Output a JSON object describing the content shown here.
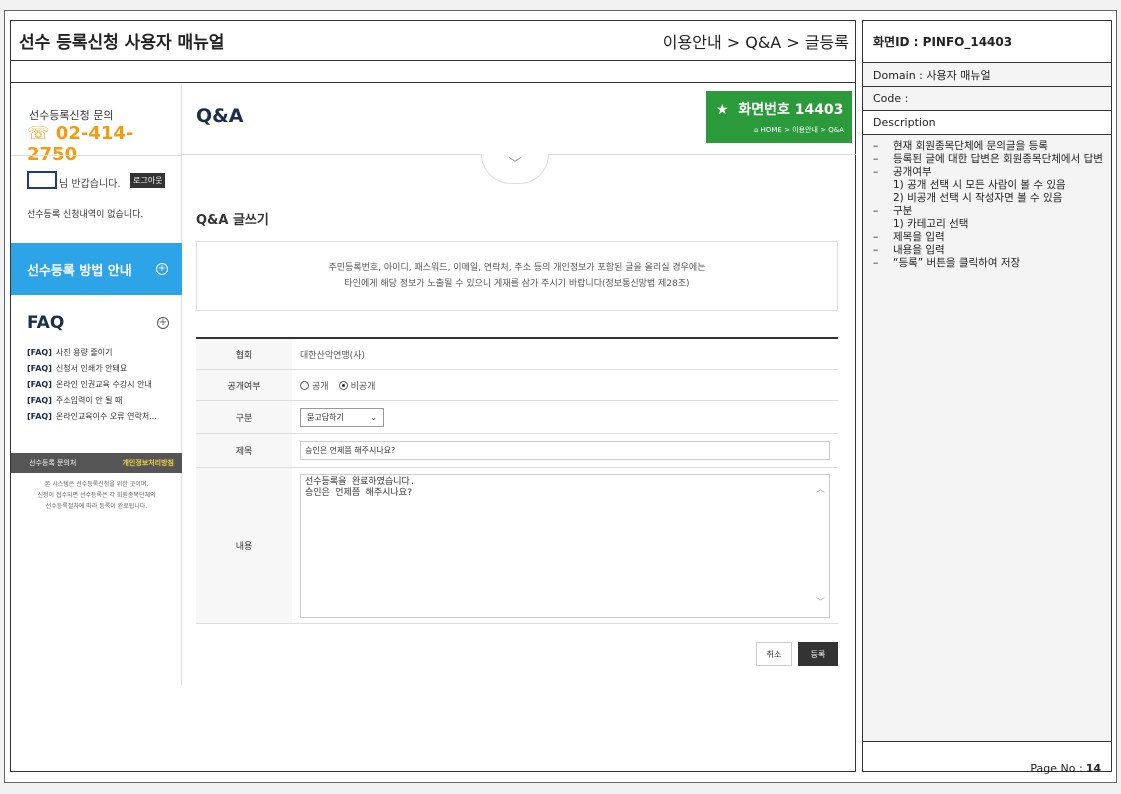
{
  "manual": {
    "title": "선수 등록신청 사용자 매뉴얼",
    "breadcrumb": "이용안내 > Q&A > 글등록"
  },
  "sidebar": {
    "inquiry_title": "선수등록신청 문의",
    "phone": "02-414-2750",
    "phone_icon": "phone-icon",
    "greeting": "님 반갑습니다.",
    "logout_label": "로그아웃",
    "no_application": "선수등록 신청내역이 없습니다.",
    "guide_label": "선수등록 방법 안내",
    "guide_icon": "plus-circle-icon",
    "faq_title": "FAQ",
    "faq_items": [
      {
        "tag": "[FAQ]",
        "text": "사진 용량 줄이기"
      },
      {
        "tag": "[FAQ]",
        "text": "신청서 인쇄가 안돼요"
      },
      {
        "tag": "[FAQ]",
        "text": "온라인 인권교육 수강시 안내"
      },
      {
        "tag": "[FAQ]",
        "text": "주소입력이 안 될 때"
      },
      {
        "tag": "[FAQ]",
        "text": "온라인교육이수 오류 연락처..."
      }
    ],
    "contact_label": "선수등록 문의처",
    "privacy_label": "개인정보처리방침",
    "system_note_1": "본 시스템은 선수등록신청을 위한 곳이며,",
    "system_note_2": "신청이 접수되면 선수등록은 각 회원종목단체의",
    "system_note_3": "선수등록절차에 따라 등록이 완료됩니다."
  },
  "content": {
    "page_title": "Q&A",
    "screen_badge": "화면번호 14403",
    "badge_icon": "star-icon",
    "badge_crumb": "HOME > 이용안내 > Q&A",
    "chevron_icon": "chevron-down-icon",
    "write_title": "Q&A 글쓰기",
    "notice_line1": "주민등록번호, 아이디, 패스워드, 이메일, 연락처, 주소 등의 개인정보가 포함된 글을 올리실 경우에는",
    "notice_line2": "타인에게 해당 정보가 노출될 수 있으니 게재를 삼가 주시기 바랍니다(정보통신망법 제28조)"
  },
  "form": {
    "assoc_label": "협회",
    "assoc_value": "대한산악연맹(사)",
    "public_label": "공개여부",
    "public_options": [
      "공개",
      "비공개"
    ],
    "public_selected": "비공개",
    "category_label": "구분",
    "category_value": "묻고답하기",
    "subject_label": "제목",
    "subject_value": "승인은 언제쯤 해주시나요?",
    "content_label": "내용",
    "content_lines": [
      "선수등록을 완료하였습니다.",
      "승인은 언제쯤 해주시나요?"
    ],
    "cancel_label": "취소",
    "submit_label": "등록"
  },
  "spec": {
    "screen_id": "화면ID : PINFO_14403",
    "domain": "Domain : 사용자 매뉴얼",
    "code": "Code :",
    "description_label": "Description",
    "description": [
      "현재 회원종목단체에 문의글을 등록",
      "등록된 글에 대한 답변은 회원종목단체에서 답변",
      "공개여부",
      "구분",
      "제목을 입력",
      "내용을 입력",
      "“등록” 버튼을 클릭하여 저장"
    ],
    "public_sub_1": "1) 공개 선택 시 모든 사람이 볼 수 있음",
    "public_sub_2": "2) 비공개 선택 시 작성자면 볼 수 있음",
    "category_sub_1": "1) 카테고리 선택",
    "page_label": "Page No :",
    "page_number": "14"
  }
}
